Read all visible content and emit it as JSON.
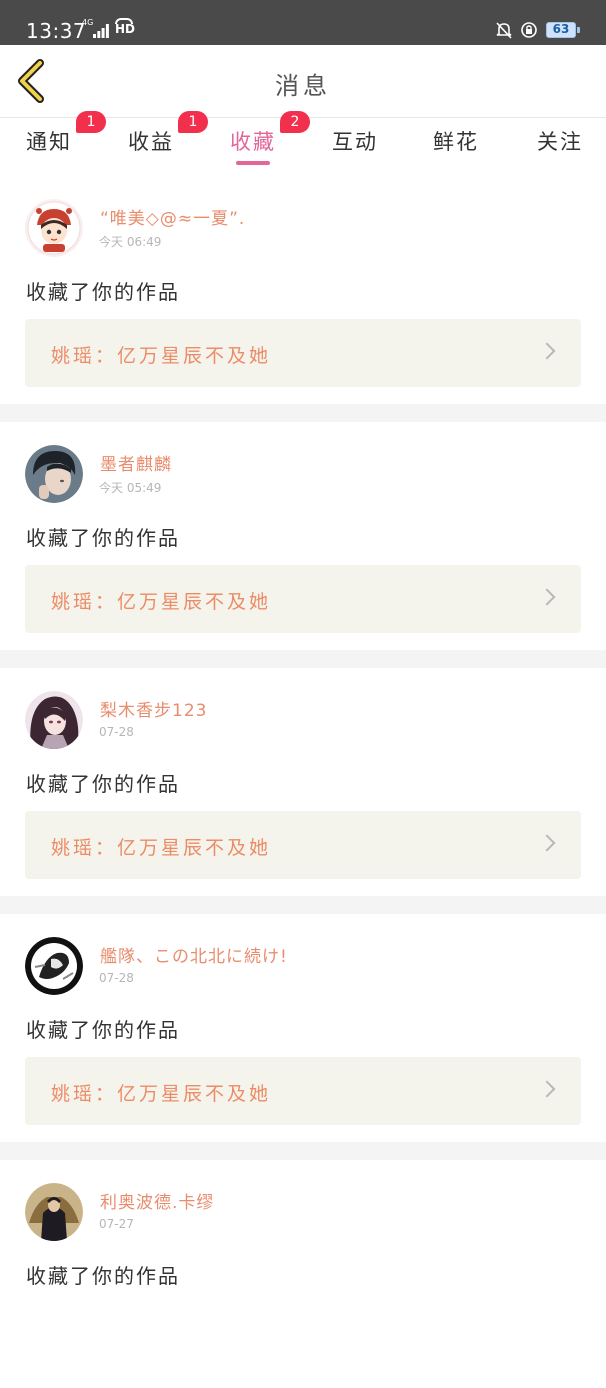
{
  "status_bar": {
    "time": "13:37",
    "network": "4G",
    "hd": "HD",
    "battery": "63"
  },
  "header": {
    "title": "消息"
  },
  "tabs": [
    {
      "label": "通知",
      "badge": "1"
    },
    {
      "label": "收益",
      "badge": "1"
    },
    {
      "label": "收藏",
      "badge": "2"
    },
    {
      "label": "互动",
      "badge": ""
    },
    {
      "label": "鲜花",
      "badge": ""
    },
    {
      "label": "关注",
      "badge": ""
    }
  ],
  "active_tab": "收藏",
  "messages": [
    {
      "username": "“唯美◇@≈一夏”.",
      "time": "今天 06:49",
      "action": "收藏了你的作品",
      "work": "姚瑶：亿万星辰不及她"
    },
    {
      "username": "墨者麒麟",
      "time": "今天 05:49",
      "action": "收藏了你的作品",
      "work": "姚瑶：亿万星辰不及她"
    },
    {
      "username": "梨木香步123",
      "time": "07-28",
      "action": "收藏了你的作品",
      "work": "姚瑶：亿万星辰不及她"
    },
    {
      "username": "艦隊、この北北に続け!",
      "time": "07-28",
      "action": "收藏了你的作品",
      "work": "姚瑶：亿万星辰不及她"
    },
    {
      "username": "利奥波德.卡缪",
      "time": "07-27",
      "action": "收藏了你的作品",
      "work": ""
    }
  ],
  "colors": {
    "accent": "#e4659a",
    "badge": "#f2304d",
    "username": "#e98c6d",
    "work_text": "#ec8c66",
    "work_bg": "#f4f4ed"
  }
}
